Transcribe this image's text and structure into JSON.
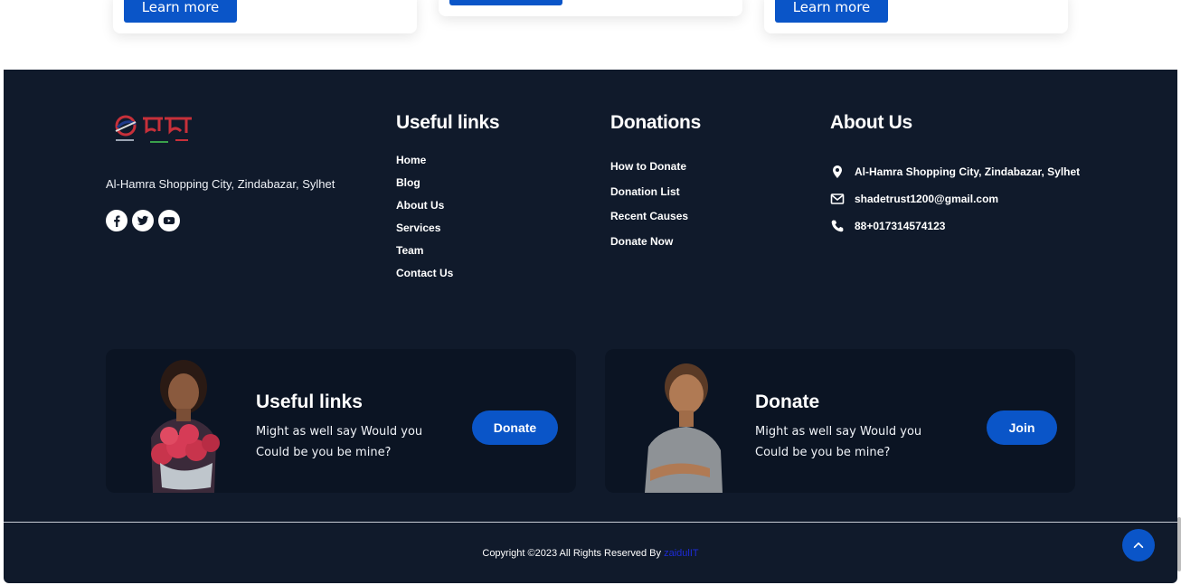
{
  "cards": [
    {
      "button": "Learn more"
    },
    {
      "button": ""
    },
    {
      "button": "Learn more"
    }
  ],
  "brand": {
    "address": "Al-Hamra Shopping City, Zindabazar, Sylhet"
  },
  "socials": [
    "facebook-icon",
    "twitter-icon",
    "youtube-icon"
  ],
  "useful_links": {
    "title": "Useful links",
    "items": [
      "Home",
      "Blog",
      "About Us",
      "Services",
      "Team",
      "Contact Us"
    ]
  },
  "donations": {
    "title": "Donations",
    "items": [
      "How to Donate",
      "Donation List",
      "Recent Causes",
      "Donate Now"
    ]
  },
  "about": {
    "title": "About Us",
    "address": "Al-Hamra Shopping City, Zindabazar, Sylhet",
    "email": "shadetrust1200@gmail.com",
    "phone": "88+017314574123"
  },
  "promos": [
    {
      "title": "Useful links",
      "text": "Might as well say Would you Could be you be mine?",
      "button": "Donate"
    },
    {
      "title": "Donate",
      "text": "Might as well say Would you Could be you be mine?",
      "button": "Join"
    }
  ],
  "copyright": {
    "text": "Copyright ©2023 All Rights Reserved By ",
    "link": "zaidulIT"
  },
  "colors": {
    "accent": "#0a55c8",
    "footer_bg": "#101a2b",
    "promo_bg": "#0b1423"
  }
}
